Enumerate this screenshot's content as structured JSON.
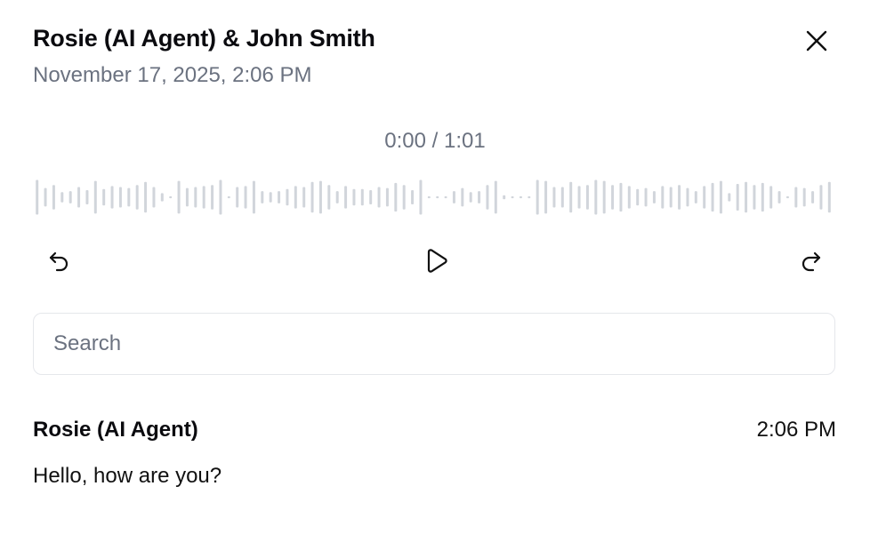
{
  "header": {
    "title": "Rosie (AI Agent) & John Smith",
    "date": "November 17, 2025, 2:06 PM"
  },
  "player": {
    "time_readout": "0:00 / 1:01",
    "progress": 0,
    "waveform_color": "#d1d5db"
  },
  "icons": {
    "close": "close-icon",
    "back": "rewind-icon",
    "play": "play-icon",
    "forward": "forward-icon"
  },
  "search": {
    "placeholder": "Search",
    "value": ""
  },
  "transcript": {
    "messages": [
      {
        "sender": "Rosie (AI Agent)",
        "time": "2:06 PM",
        "text": "Hello, how are you?"
      }
    ]
  }
}
